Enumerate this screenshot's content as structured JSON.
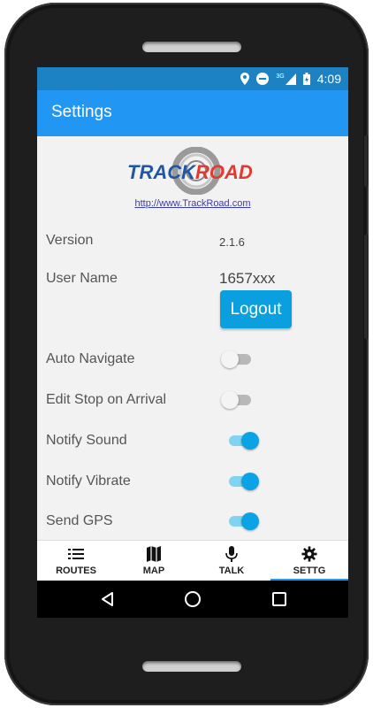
{
  "status_bar": {
    "time": "4:09",
    "network": "3G",
    "icons": [
      "location-icon",
      "do-not-disturb-icon",
      "signal-icon",
      "battery-icon"
    ]
  },
  "app_bar": {
    "title": "Settings"
  },
  "brand": {
    "logo_text_1": "TRACK",
    "logo_text_2": "ROAD",
    "link": "http://www.TrackRoad.com"
  },
  "settings": {
    "version_label": "Version",
    "version_value": "2.1.6",
    "username_label": "User Name",
    "username_value": "1657xxx",
    "logout_label": "Logout",
    "toggles": [
      {
        "label": "Auto Navigate",
        "on": false
      },
      {
        "label": "Edit Stop on Arrival",
        "on": false
      },
      {
        "label": "Notify Sound",
        "on": true
      },
      {
        "label": "Notify Vibrate",
        "on": true
      },
      {
        "label": "Send GPS",
        "on": true
      }
    ]
  },
  "tabs": [
    {
      "label": "ROUTES",
      "icon": "list-icon",
      "active": false
    },
    {
      "label": "MAP",
      "icon": "map-icon",
      "active": false
    },
    {
      "label": "TALK",
      "icon": "microphone-icon",
      "active": false
    },
    {
      "label": "SETTG",
      "icon": "gear-icon",
      "active": true
    }
  ],
  "colors": {
    "status_bar": "#1c82c3",
    "app_bar": "#2196f3",
    "accent": "#0aa3e6",
    "logo_blue": "#2255a4",
    "logo_red": "#e23a2e"
  }
}
